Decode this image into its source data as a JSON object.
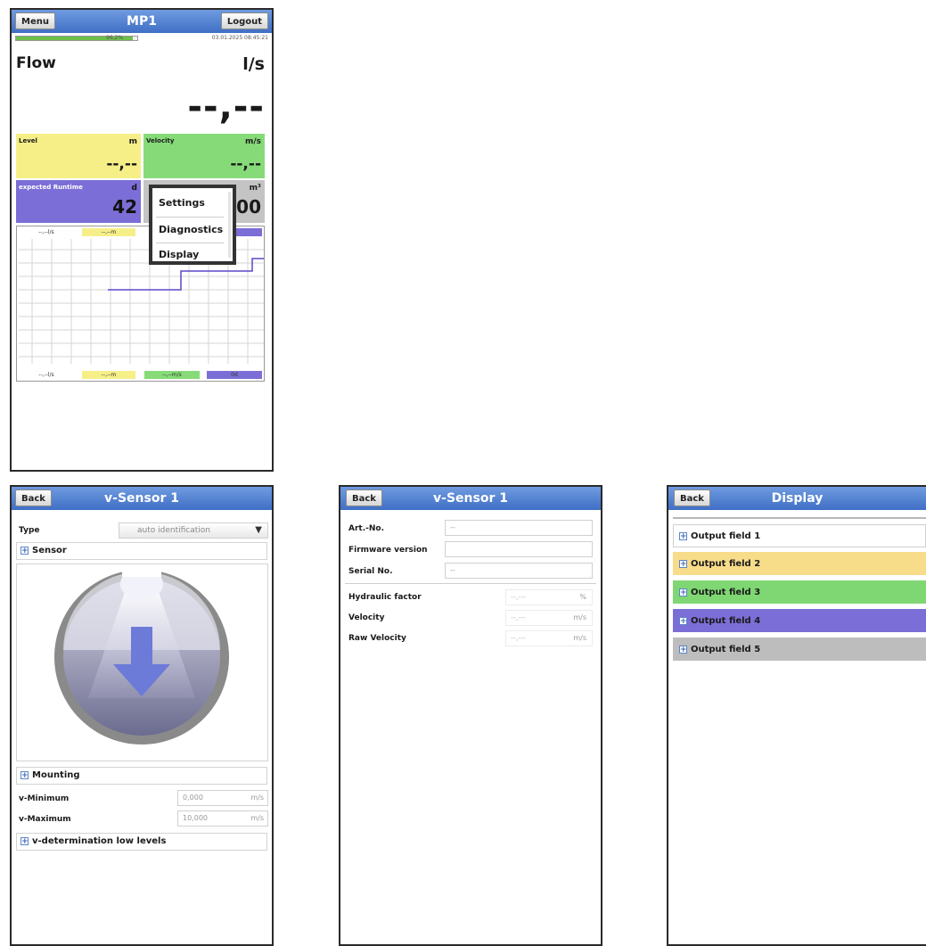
{
  "main": {
    "title": "MP1",
    "menu_label": "Menu",
    "logout_label": "Logout",
    "progress_text": "96,2%",
    "progress_fraction": 0.962,
    "timestamp": "03.01.2025 08:45:21",
    "flow_label": "Flow",
    "flow_unit": "l/s",
    "flow_value": "--,--",
    "tiles": [
      {
        "label": "Level",
        "unit": "m",
        "value": "--,--",
        "color": "#f6ef88"
      },
      {
        "label": "Velocity",
        "unit": "m/s",
        "value": "--,--",
        "color": "#86db78"
      },
      {
        "label": "expected Runtime",
        "unit": "d",
        "value": "42",
        "color": "#7b6ed6"
      },
      {
        "label": "",
        "unit": "m³",
        "value": "000",
        "color": "#c4c4c4"
      }
    ],
    "popup_menu": [
      "Settings",
      "Diagnostics",
      "Display"
    ],
    "chart_top_chips": [
      "--,--l/s",
      "--,--m",
      "",
      "d"
    ],
    "chart_bottom_chips": [
      "--,--l/s",
      "--,--m",
      "--,--m/s",
      "0d"
    ]
  },
  "vsensor": {
    "title": "v-Sensor 1",
    "back_label": "Back",
    "type_label": "Type",
    "type_value": "auto identification",
    "sensor_section": "Sensor",
    "mounting_section": "Mounting",
    "vmin_label": "v-Minimum",
    "vmin_value": "0,000",
    "vmin_unit": "m/s",
    "vmax_label": "v-Maximum",
    "vmax_value": "10,000",
    "vmax_unit": "m/s",
    "low_levels_section": "v-determination low levels"
  },
  "diag": {
    "title": "v-Sensor 1",
    "back_label": "Back",
    "rows": [
      {
        "label": "Art.-No.",
        "value": "--"
      },
      {
        "label": "Firmware version",
        "value": ""
      },
      {
        "label": "Serial No.",
        "value": "--"
      }
    ],
    "measures": [
      {
        "label": "Hydraulic factor",
        "value": "--,---",
        "unit": "%"
      },
      {
        "label": "Velocity",
        "value": "--,---",
        "unit": "m/s"
      },
      {
        "label": "Raw Velocity",
        "value": "--,---",
        "unit": "m/s"
      }
    ]
  },
  "display": {
    "title": "Display",
    "back_label": "Back",
    "fields": [
      {
        "label": "Output field 1",
        "color": "#ffffff"
      },
      {
        "label": "Output field 2",
        "color": "#f7dc8a"
      },
      {
        "label": "Output field 3",
        "color": "#7fd773"
      },
      {
        "label": "Output field 4",
        "color": "#7b6ed6"
      },
      {
        "label": "Output field 5",
        "color": "#bdbdbd"
      }
    ]
  }
}
